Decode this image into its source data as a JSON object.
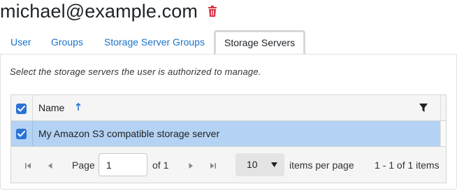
{
  "header": {
    "email": "michael@example.com",
    "delete_icon": "trash-icon",
    "delete_color": "#dc3545"
  },
  "tabs": [
    {
      "label": "User",
      "active": false
    },
    {
      "label": "Groups",
      "active": false
    },
    {
      "label": "Storage Server Groups",
      "active": false
    },
    {
      "label": "Storage Servers",
      "active": true
    }
  ],
  "instruction": "Select the storage servers the user is authorized to manage.",
  "grid": {
    "select_all_checked": true,
    "columns": [
      {
        "label": "Name",
        "sort": "ascending",
        "sort_icon": "sort-ascending-icon",
        "filter_icon": "filter-icon"
      }
    ],
    "rows": [
      {
        "name": "My Amazon S3 compatible storage server",
        "checked": true,
        "selected": true
      }
    ],
    "pager": {
      "page_label": "Page",
      "page_value": "1",
      "of_label": "of 1",
      "page_size": "10",
      "items_per_page_label": "items per page",
      "range_text": "1 - 1 of 1 items"
    }
  },
  "colors": {
    "accent": "#2a73d4",
    "link": "#1a73c8",
    "selected_row": "#b4d2f4"
  }
}
